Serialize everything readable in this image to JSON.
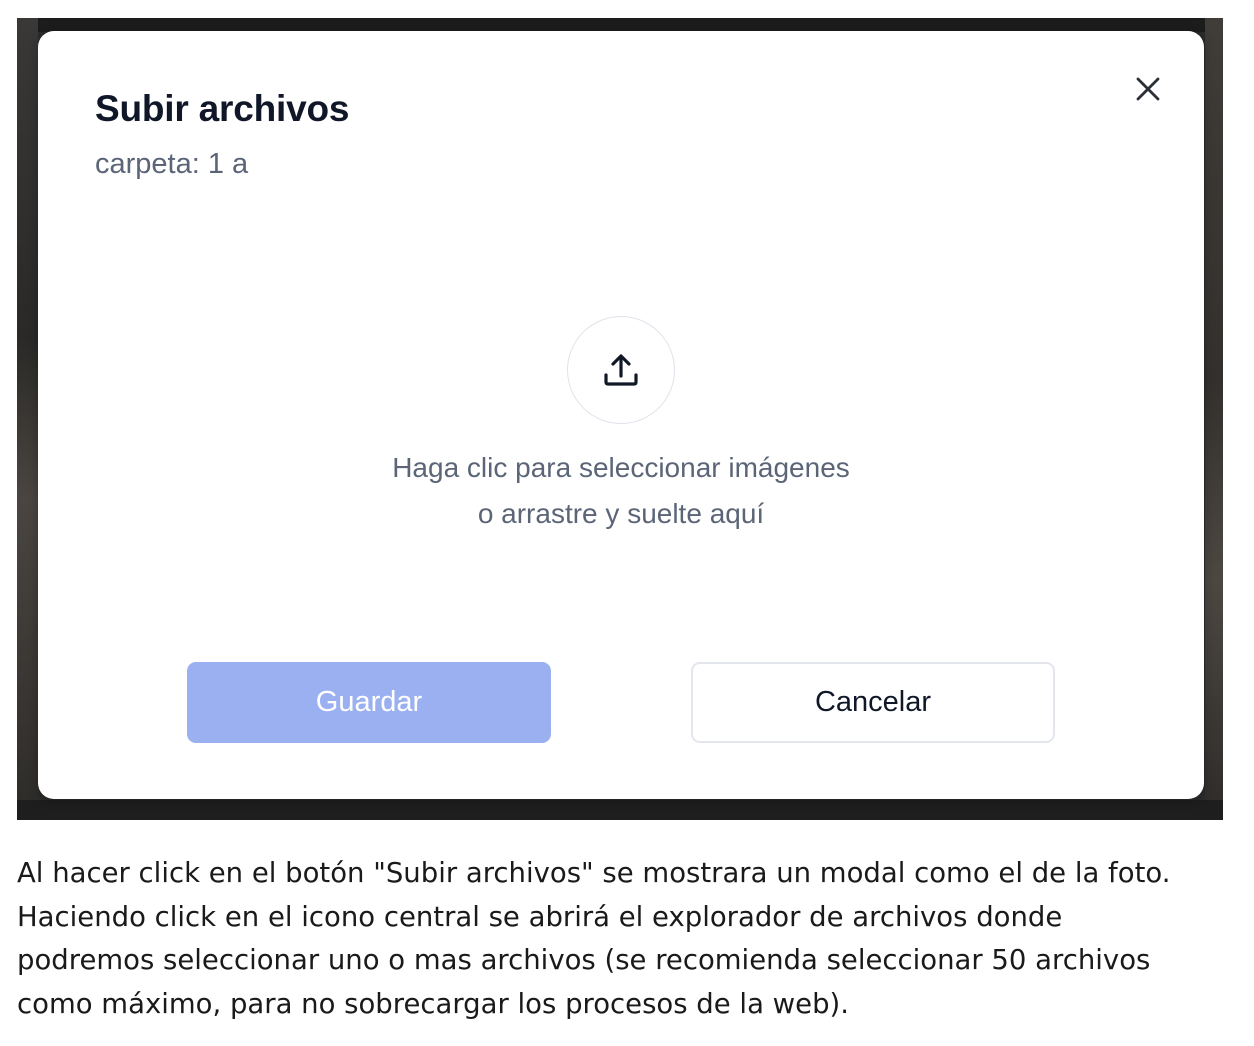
{
  "modal": {
    "title": "Subir archivos",
    "subtitle": "carpeta: 1 a",
    "close_icon": "close-icon",
    "upload_icon": "upload-icon",
    "upload_text_line1": "Haga clic para seleccionar imágenes",
    "upload_text_line2": "o arrastre y suelte aquí",
    "save_label": "Guardar",
    "cancel_label": "Cancelar"
  },
  "colors": {
    "save_button_bg": "#9bb0f0",
    "title_text": "#0f1729",
    "muted_text": "#5b6577"
  },
  "caption": {
    "line1": "Al hacer click en el botón \"Subir archivos\" se mostrara un modal como el de la foto.",
    "line2": "Haciendo click en el icono central se abrirá el explorador de archivos donde",
    "line3": "podremos seleccionar uno o mas archivos (se recomienda seleccionar 50 archivos",
    "line4": "como máximo, para no sobrecargar los procesos de la web)."
  }
}
